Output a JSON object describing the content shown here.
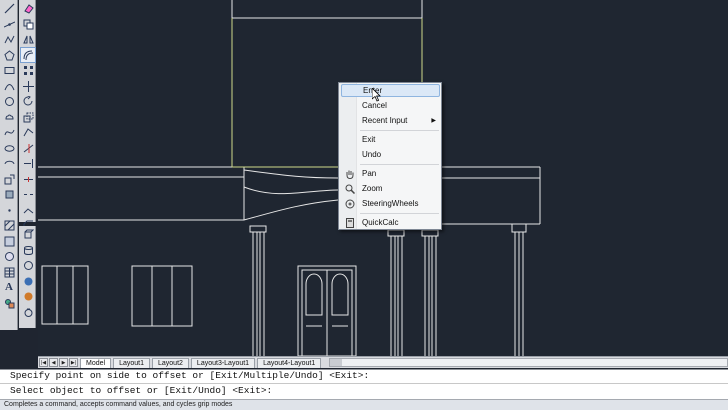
{
  "context_menu": {
    "items": [
      {
        "label": "Enter",
        "highlighted": true
      },
      {
        "label": "Cancel"
      },
      {
        "label": "Recent Input",
        "submenu": true
      },
      {
        "label": "Exit"
      },
      {
        "label": "Undo"
      },
      {
        "label": "Pan",
        "icon": "pan-hand-icon"
      },
      {
        "label": "Zoom",
        "icon": "zoom-magnifier-icon"
      },
      {
        "label": "SteeringWheels",
        "icon": "steering-wheel-icon"
      },
      {
        "label": "QuickCalc",
        "icon": "calculator-icon"
      }
    ]
  },
  "layout_tabs": [
    "Model",
    "Layout1",
    "Layout2",
    "Layout3-Layout1",
    "Layout4-Layout1"
  ],
  "active_tab": "Model",
  "command_line": {
    "line1": "Specify point on side to offset or [Exit/Multiple/Undo] <Exit>:",
    "line2": "Select object to offset or [Exit/Undo] <Exit>:"
  },
  "status_text": "Completes a command, accepts command values, and cycles grip modes",
  "colors": {
    "canvas": "#1f2631",
    "drawing_lines": "#e8e8e8",
    "highlight_lines": "#cfd98a",
    "menu_highlight": "#dbe8f7"
  }
}
